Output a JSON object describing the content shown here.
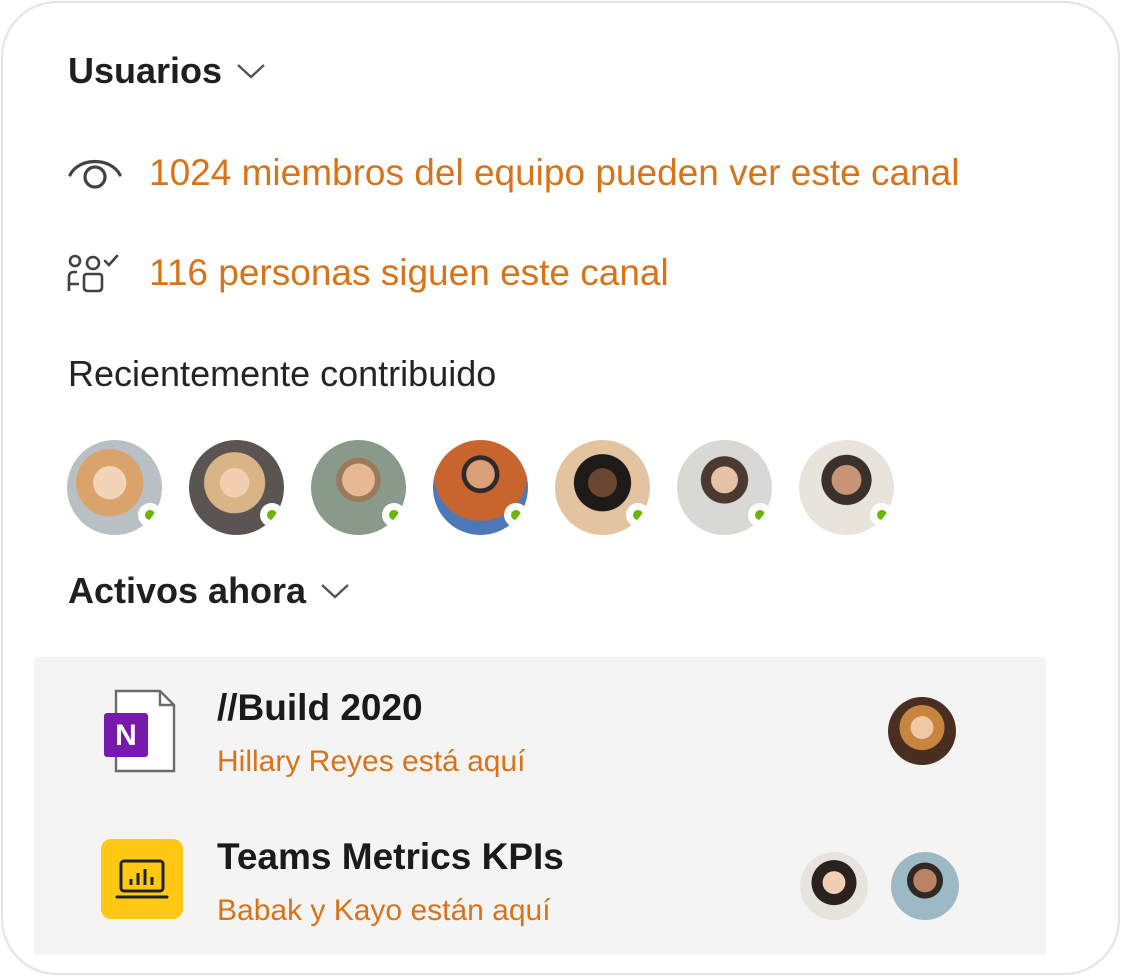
{
  "users": {
    "title": "Usuarios",
    "members_text": "1024 miembros del equipo pueden ver este canal",
    "followers_text": "116 personas siguen este canal"
  },
  "recent": {
    "label": "Recientemente contribuido",
    "avatar_count": 7
  },
  "active": {
    "title": "Activos ahora",
    "items": [
      {
        "title": "//Build 2020",
        "subtitle": "Hillary Reyes está aquí",
        "app_icon": "onenote-icon",
        "app_letter": "N"
      },
      {
        "title": "Teams Metrics KPIs",
        "subtitle": "Babak y Kayo están aquí",
        "app_icon": "powerbi-icon"
      }
    ]
  },
  "colors": {
    "accent": "#d9731a",
    "presence": "#6bb700",
    "onenote": "#7719aa",
    "powerbi": "#f2c811"
  }
}
